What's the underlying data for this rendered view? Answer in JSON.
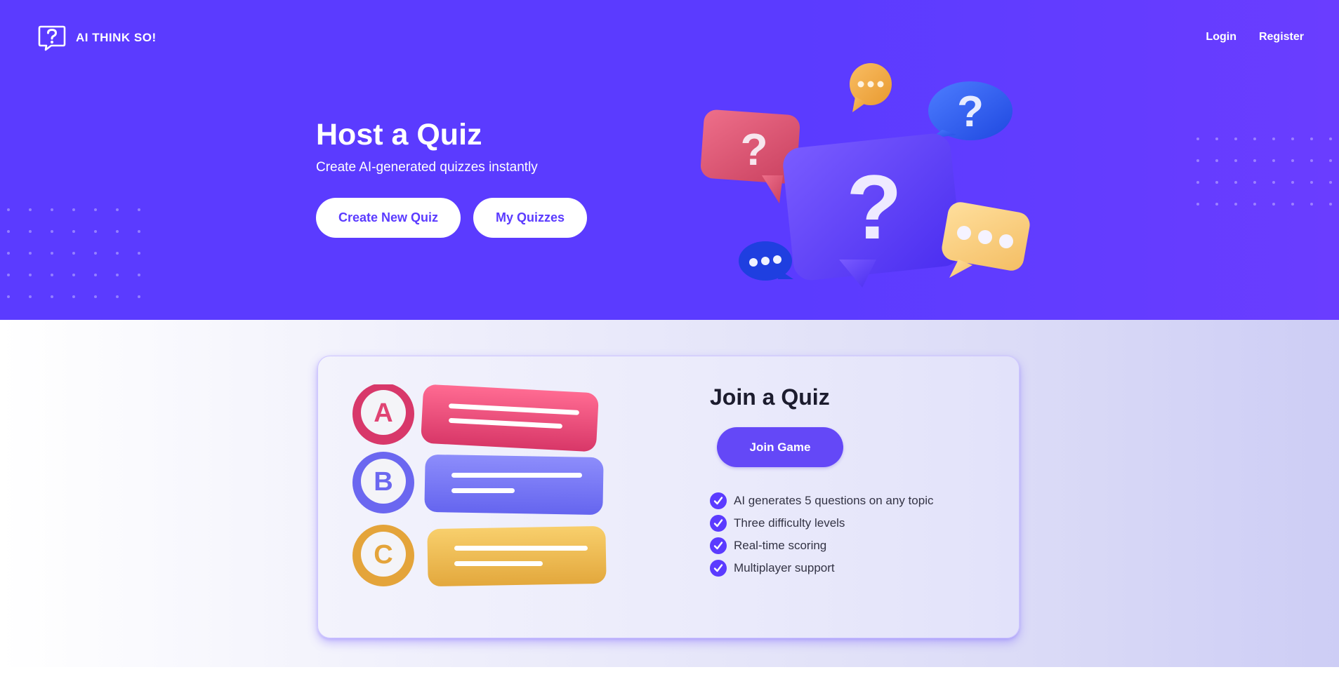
{
  "brand": {
    "name": "AI THINK SO!",
    "accent": "#5b3bff"
  },
  "nav": {
    "login": "Login",
    "register": "Register"
  },
  "hero": {
    "title": "Host a Quiz",
    "subtitle": "Create AI-generated quizzes instantly",
    "create_button": "Create New Quiz",
    "my_quizzes_button": "My Quizzes"
  },
  "join": {
    "title": "Join a Quiz",
    "button": "Join Game",
    "options": [
      "A",
      "B",
      "C"
    ],
    "features": [
      "AI generates 5 questions on any topic",
      "Three difficulty levels",
      "Real-time scoring",
      "Multiplayer support"
    ]
  },
  "icons": {
    "logo": "question-bubble-icon",
    "feature": "check-circle-icon"
  }
}
